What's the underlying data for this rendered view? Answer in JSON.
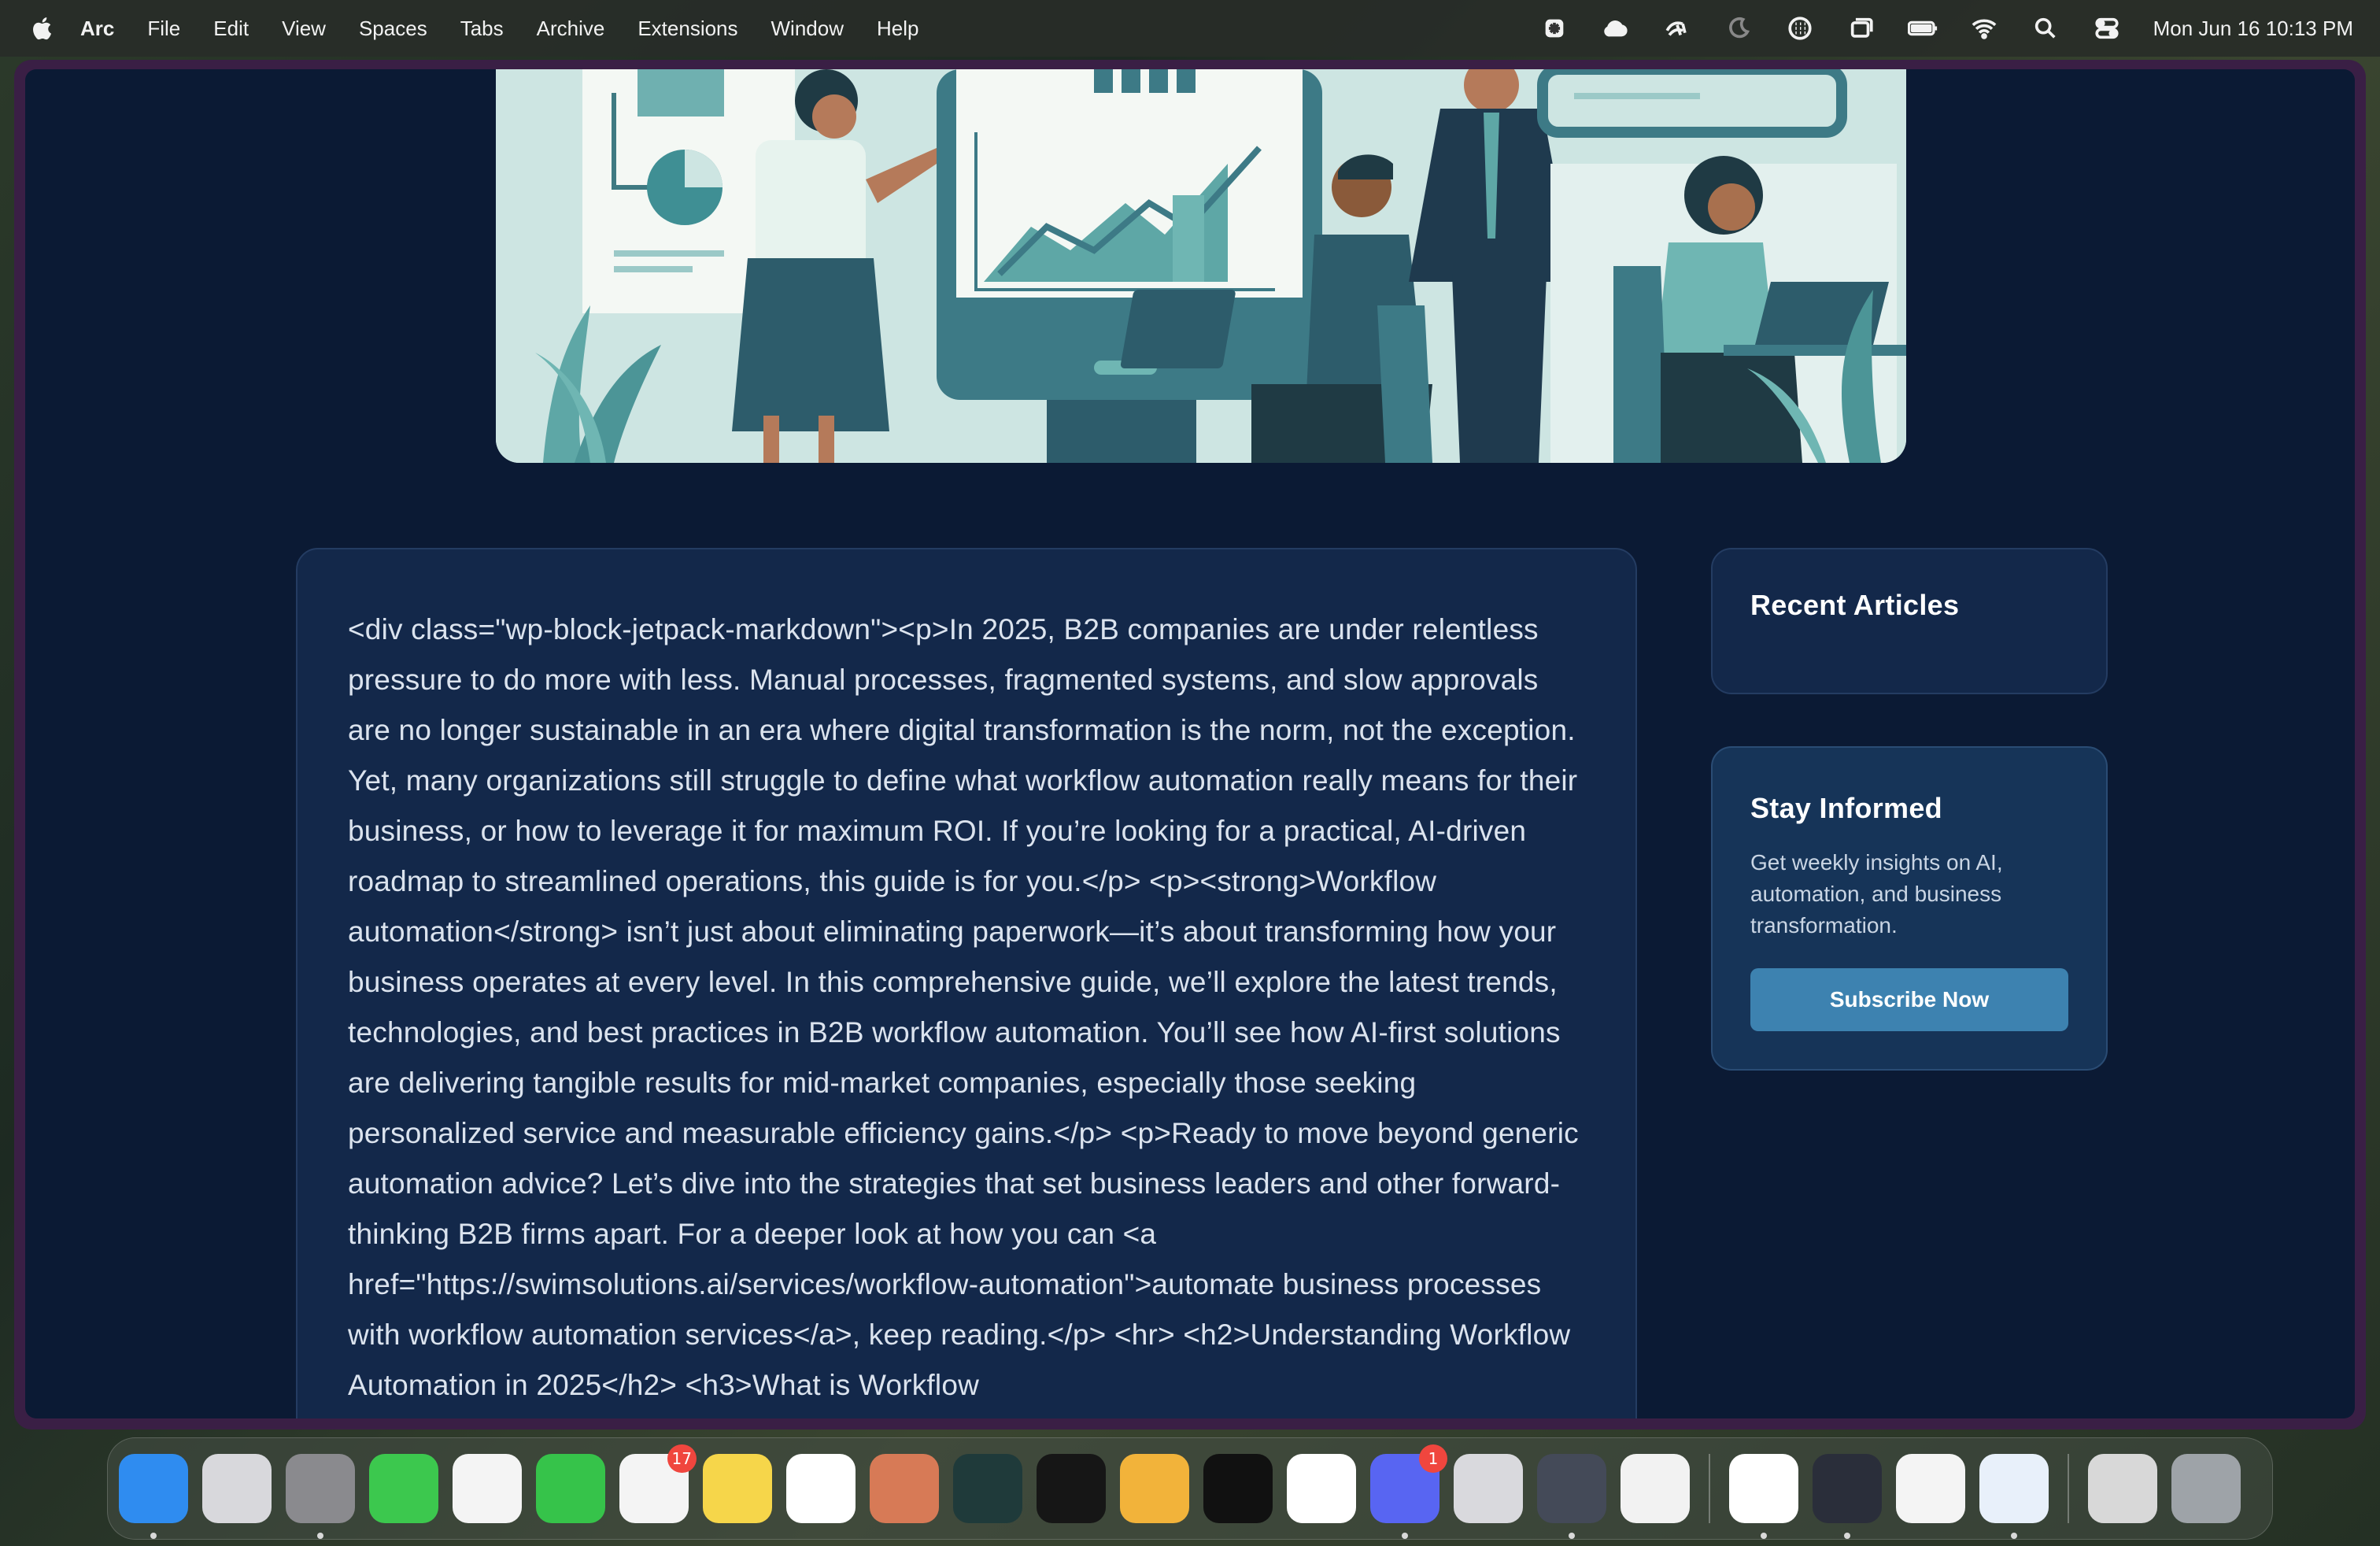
{
  "menubar": {
    "app_name": "Arc",
    "menus": [
      "File",
      "Edit",
      "View",
      "Spaces",
      "Tabs",
      "Archive",
      "Extensions",
      "Window",
      "Help"
    ],
    "status_icons": [
      "perplexity-icon",
      "cloud-icon",
      "mesh-icon",
      "moon-icon",
      "grid-icon",
      "stage-manager-icon",
      "battery-icon",
      "wifi-icon",
      "search-icon",
      "control-center-icon"
    ],
    "clock": "Mon Jun 16  10:13 PM"
  },
  "article": {
    "body": "<div class=\"wp-block-jetpack-markdown\"><p>In 2025, B2B companies are under relentless pressure to do more with less. Manual processes, fragmented systems, and slow approvals are no longer sustainable in an era where digital transformation is the norm, not the exception. Yet, many organizations still struggle to define what workflow automation really means for their business, or how to leverage it for maximum ROI. If you’re looking for a practical, AI-driven roadmap to streamlined operations, this guide is for you.</p> <p><strong>Workflow automation</strong> isn’t just about eliminating paperwork—it’s about transforming how your business operates at every level. In this comprehensive guide, we’ll explore the latest trends, technologies, and best practices in B2B workflow automation. You’ll see how AI-first solutions are delivering tangible results for mid-market companies, especially those seeking personalized service and measurable efficiency gains.</p> <p>Ready to move beyond generic automation advice? Let’s dive into the strategies that set business leaders and other forward-thinking B2B firms apart. For a deeper look at how you can <a href=\"https://swimsolutions.ai/services/workflow-automation\">automate business processes with workflow automation services</a>, keep reading.</p> <hr> <h2>Understanding Workflow Automation in 2025</h2> <h3>What is Workflow"
  },
  "sidebar": {
    "recent_title": "Recent Articles",
    "subscribe_title": "Stay Informed",
    "subscribe_desc": "Get weekly insights on AI, automation, and business transformation.",
    "subscribe_button": "Subscribe Now"
  },
  "dock": {
    "apps": [
      {
        "name": "finder",
        "bg": "#2f8cf0",
        "running": true
      },
      {
        "name": "launchpad",
        "bg": "#d8d8dc"
      },
      {
        "name": "system-settings",
        "bg": "#8a8a8e",
        "running": true
      },
      {
        "name": "messages",
        "bg": "#3cc84e"
      },
      {
        "name": "photos",
        "bg": "#f4f4f4"
      },
      {
        "name": "facetime",
        "bg": "#36c34a"
      },
      {
        "name": "reminders",
        "bg": "#f4f4f4",
        "badge": "17"
      },
      {
        "name": "notes",
        "bg": "#f6d64a"
      },
      {
        "name": "chatgpt",
        "bg": "#ffffff"
      },
      {
        "name": "claude",
        "bg": "#d77a56"
      },
      {
        "name": "perplexity",
        "bg": "#1f3a3a"
      },
      {
        "name": "app-orange",
        "bg": "#161616"
      },
      {
        "name": "mail-spark",
        "bg": "#f2b33a"
      },
      {
        "name": "screenshot-app",
        "bg": "#111111"
      },
      {
        "name": "notion",
        "bg": "#ffffff"
      },
      {
        "name": "discord",
        "bg": "#5865f2",
        "badge": "1",
        "running": true
      },
      {
        "name": "iphone-mirroring",
        "bg": "#d9d9dd"
      },
      {
        "name": "app-star",
        "bg": "#444a58",
        "running": true
      },
      {
        "name": "passwords",
        "bg": "#f2f2f2"
      },
      {
        "name": "slack",
        "bg": "#ffffff",
        "separator_before": true,
        "running": true
      },
      {
        "name": "obs",
        "bg": "#2a2e3a",
        "running": true
      },
      {
        "name": "chrome",
        "bg": "#f4f4f4"
      },
      {
        "name": "safari",
        "bg": "#e8f0fa",
        "running": true
      },
      {
        "name": "downloads-folder",
        "bg": "#d8d8d8",
        "separator_before": true
      },
      {
        "name": "trash",
        "bg": "#9ea3a8"
      }
    ]
  }
}
